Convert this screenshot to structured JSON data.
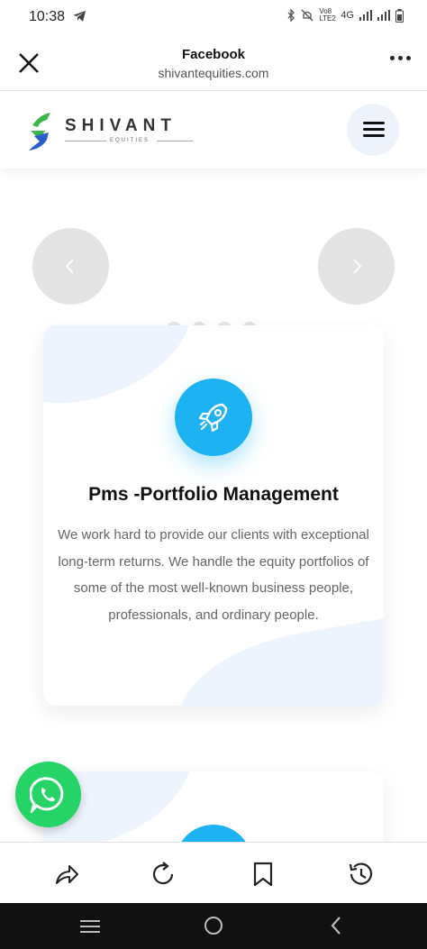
{
  "status_bar": {
    "time": "10:38",
    "network_label": "Vo8 LTE2",
    "network_type": "4G",
    "icons": [
      "telegram-icon",
      "bluetooth-icon",
      "mute-icon",
      "signal-icon",
      "battery-icon"
    ]
  },
  "browser": {
    "title": "Facebook",
    "url": "shivantequities.com",
    "icons": [
      "close-icon",
      "more-icon"
    ]
  },
  "site": {
    "brand": "SHIVANT",
    "brand_sub": "EQUITIES",
    "menu_icon": "hamburger-icon"
  },
  "carousel": {
    "prev_icon": "chevron-left-icon",
    "next_icon": "chevron-right-icon",
    "dots_count": 4
  },
  "card": {
    "icon": "rocket-icon",
    "heading": "Pms -Portfolio Management",
    "description": "We work hard to provide our clients with exceptional long-term returns. We handle the equity portfolios of some of the most well-known business people, professionals, and ordinary people."
  },
  "floating": {
    "icon": "whatsapp-icon"
  },
  "toolbar": {
    "icons": [
      "share-icon",
      "refresh-icon",
      "bookmark-icon",
      "history-icon"
    ]
  },
  "system_nav": {
    "icons": [
      "recents-icon",
      "home-icon",
      "back-icon"
    ]
  },
  "colors": {
    "accent": "#1db2f2",
    "whatsapp": "#25d366",
    "logo_green": "#3bb54a",
    "logo_blue": "#2a5fc9"
  }
}
